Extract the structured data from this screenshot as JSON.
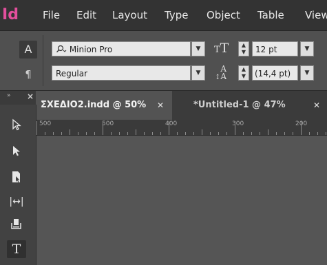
{
  "app": {
    "logo": "Id"
  },
  "menubar": {
    "items": [
      "File",
      "Edit",
      "Layout",
      "Type",
      "Object",
      "Table",
      "View"
    ]
  },
  "control_panel": {
    "char_button": "A",
    "para_button": "¶",
    "font_family": {
      "value": "Minion Pro",
      "icon": "search-icon"
    },
    "font_style": {
      "value": "Regular"
    },
    "font_size": {
      "value": "12 pt",
      "icon": "font-size-icon"
    },
    "leading": {
      "value": "(14,4 pt)",
      "icon": "leading-icon"
    }
  },
  "tools_panel": {
    "header": "» —",
    "tools": [
      {
        "name": "direct-selection-tool",
        "glyph": "▷"
      },
      {
        "name": "selection-tool",
        "glyph": "▶"
      },
      {
        "name": "page-tool",
        "glyph": "❐"
      },
      {
        "name": "gap-tool",
        "glyph": "|↔|"
      },
      {
        "name": "content-collector-tool",
        "glyph": "⌹"
      },
      {
        "name": "type-tool",
        "glyph": "T"
      }
    ]
  },
  "document_tabs": [
    {
      "label": "ΣΧΕΔΙΟ2.indd @ 50%",
      "active": true
    },
    {
      "label": "*Untitled-1 @ 47%",
      "active": false
    }
  ],
  "ruler": {
    "labels": [
      "500",
      "500",
      "400",
      "300",
      "200"
    ]
  },
  "colors": {
    "accent": "#e24f9c",
    "background": "#535353"
  }
}
